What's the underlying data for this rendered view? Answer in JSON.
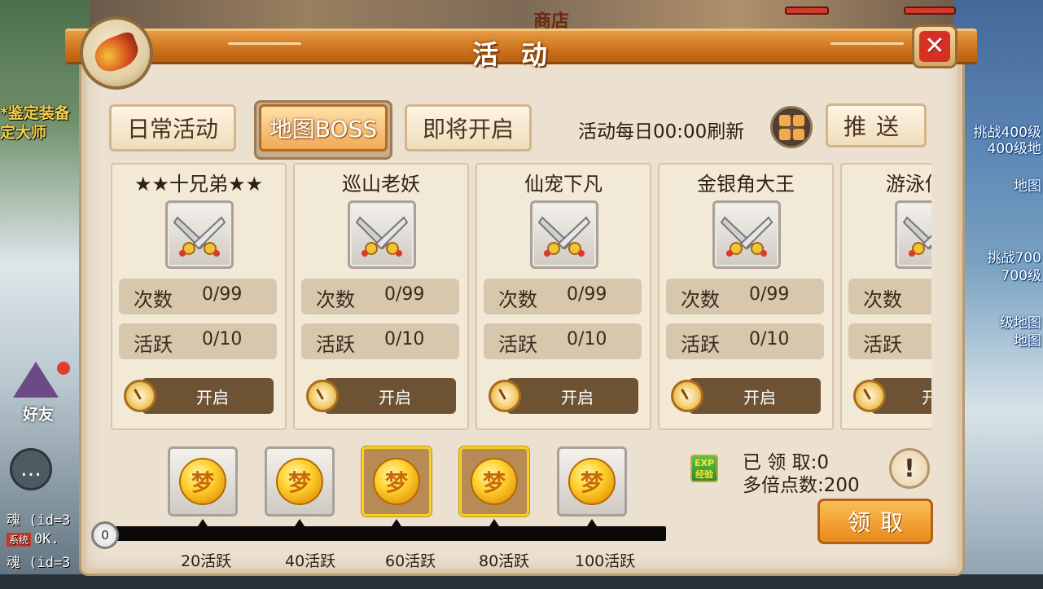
{
  "panel": {
    "title": "活动",
    "close_icon": "close-x-icon",
    "header_icon": "horn-icon"
  },
  "tabs": [
    {
      "label": "日常活动",
      "active": false
    },
    {
      "label": "地图BOSS",
      "active": true
    },
    {
      "label": "即将开启",
      "active": false
    }
  ],
  "refresh_text": "活动每日00:00刷新",
  "push_button": "推送",
  "cards": [
    {
      "name": "★★十兄弟★★",
      "icon": "crossed-swords-icon",
      "count_label": "次数",
      "count_value": "0/99",
      "active_label": "活跃",
      "active_value": "0/10",
      "button": "开启"
    },
    {
      "name": "巡山老妖",
      "icon": "crossed-swords-icon",
      "count_label": "次数",
      "count_value": "0/99",
      "active_label": "活跃",
      "active_value": "0/10",
      "button": "开启"
    },
    {
      "name": "仙宠下凡",
      "icon": "crossed-swords-icon",
      "count_label": "次数",
      "count_value": "0/99",
      "active_label": "活跃",
      "active_value": "0/10",
      "button": "开启"
    },
    {
      "name": "金银角大王",
      "icon": "crossed-swords-icon",
      "count_label": "次数",
      "count_value": "0/99",
      "active_label": "活跃",
      "active_value": "0/10",
      "button": "开启"
    },
    {
      "name": "游泳仙",
      "icon": "crossed-swords-icon",
      "count_label": "次数",
      "count_value": "",
      "active_label": "活跃",
      "active_value": "",
      "button": "开"
    }
  ],
  "rewards": [
    {
      "label": "20活跃",
      "ready": false
    },
    {
      "label": "40活跃",
      "ready": false
    },
    {
      "label": "60活跃",
      "ready": true
    },
    {
      "label": "80活跃",
      "ready": true
    },
    {
      "label": "100活跃",
      "ready": false
    }
  ],
  "coin_glyph": "梦",
  "progress": {
    "value": "0",
    "fraction": 0
  },
  "claimed_text": "已 领 取:0",
  "multiplier_text": "多倍点数:200",
  "exp_icon_text": "EXP 经验",
  "help_glyph": "!",
  "claim_button": "领取",
  "background": {
    "top_center": "商店",
    "left_texts": [
      "*鉴定装备",
      "定大师"
    ],
    "right_texts": [
      "挑战400级",
      "400级地",
      "地图",
      "挑战700",
      "700级",
      "级地图",
      "地图"
    ],
    "friend_label": "好友",
    "chat_icon": "chat-bubble-icon",
    "chat_lines": [
      "魂 (id=3",
      "0K.",
      "魂 (id=3"
    ],
    "system_tag": "系统"
  }
}
